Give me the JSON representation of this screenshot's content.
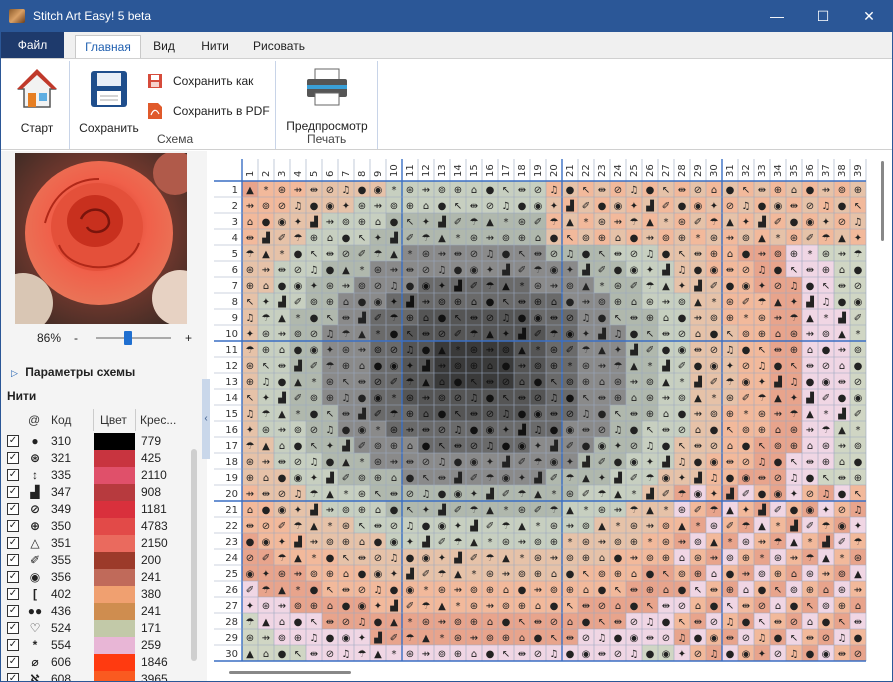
{
  "titlebar": {
    "title": "Stitch Art Easy! 5 beta",
    "minimize": "—",
    "maximize": "☐",
    "close": "✕"
  },
  "menu_tabs": [
    "Файл",
    "Главная",
    "Вид",
    "Нити",
    "Рисовать"
  ],
  "active_tab": "Главная",
  "ribbon": {
    "start_label": "Старт",
    "save_label": "Сохранить",
    "save_as_label": "Сохранить как",
    "save_pdf_label": "Сохранить в PDF",
    "scheme_group": "Схема",
    "preview_label": "Предпросмотр",
    "print_group": "Печать"
  },
  "colors": {
    "accent": "#2b5797",
    "grid_major": "#3a6fc4",
    "grid_minor": "#9aa8c0",
    "house_roof": "#c0392b",
    "pdf_red": "#e05a2b"
  },
  "zoom": {
    "percent": "86%",
    "minus": "-",
    "plus": "+",
    "level": 0.42
  },
  "scheme_params": "Параметры схемы",
  "threads_title": "Нити",
  "thread_headers": {
    "symbol": "@",
    "code": "Код",
    "color": "Цвет",
    "crosses": "Крес..."
  },
  "threads": [
    {
      "checked": "✓",
      "symbol": "●",
      "code": "310",
      "color": "#000000",
      "count": "779"
    },
    {
      "checked": "✓",
      "symbol": "⊛",
      "code": "321",
      "color": "#c8343f",
      "count": "425"
    },
    {
      "checked": "✓",
      "symbol": "↕",
      "code": "335",
      "color": "#e0506a",
      "count": "2110"
    },
    {
      "checked": "✓",
      "symbol": "▟",
      "code": "347",
      "color": "#b73a3e",
      "count": "908"
    },
    {
      "checked": "✓",
      "symbol": "⊘",
      "code": "349",
      "color": "#d9303c",
      "count": "1181"
    },
    {
      "checked": "✓",
      "symbol": "⊕",
      "code": "350",
      "color": "#e24a48",
      "count": "4783"
    },
    {
      "checked": "✓",
      "symbol": "△",
      "code": "351",
      "color": "#ea6a5e",
      "count": "2150"
    },
    {
      "checked": "✓",
      "symbol": "✐",
      "code": "355",
      "color": "#9c3a2a",
      "count": "200"
    },
    {
      "checked": "✓",
      "symbol": "◉",
      "code": "356",
      "color": "#c06a5a",
      "count": "241"
    },
    {
      "checked": "✓",
      "symbol": "[",
      "code": "402",
      "color": "#f0a070",
      "count": "380"
    },
    {
      "checked": "✓",
      "symbol": "●●",
      "code": "436",
      "color": "#cf8d4f",
      "count": "241"
    },
    {
      "checked": "✓",
      "symbol": "♡",
      "code": "524",
      "color": "#c2c9a8",
      "count": "171"
    },
    {
      "checked": "✓",
      "symbol": "*",
      "code": "554",
      "color": "#e8b6d6",
      "count": "259"
    },
    {
      "checked": "✓",
      "symbol": "⌀",
      "code": "606",
      "color": "#ff3a10",
      "count": "1846"
    },
    {
      "checked": "✓",
      "symbol": "ℵ",
      "code": "608",
      "color": "#fa5a20",
      "count": "3965"
    }
  ],
  "grid": {
    "columns": [
      "1",
      "2",
      "3",
      "4",
      "5",
      "6",
      "7",
      "8",
      "9",
      "10",
      "11",
      "12",
      "13",
      "14",
      "15",
      "16",
      "17",
      "18",
      "19",
      "20",
      "21",
      "22",
      "23",
      "24",
      "25",
      "26",
      "27",
      "28",
      "29",
      "30",
      "31",
      "32",
      "33",
      "34",
      "35",
      "36",
      "37",
      "38",
      "39"
    ],
    "rows": [
      "1",
      "2",
      "3",
      "4",
      "5",
      "6",
      "7",
      "8",
      "9",
      "10",
      "11",
      "12",
      "13",
      "14",
      "15",
      "16",
      "17",
      "18",
      "19",
      "20",
      "21",
      "22",
      "23",
      "24",
      "25",
      "26",
      "27",
      "28",
      "29",
      "30"
    ]
  }
}
